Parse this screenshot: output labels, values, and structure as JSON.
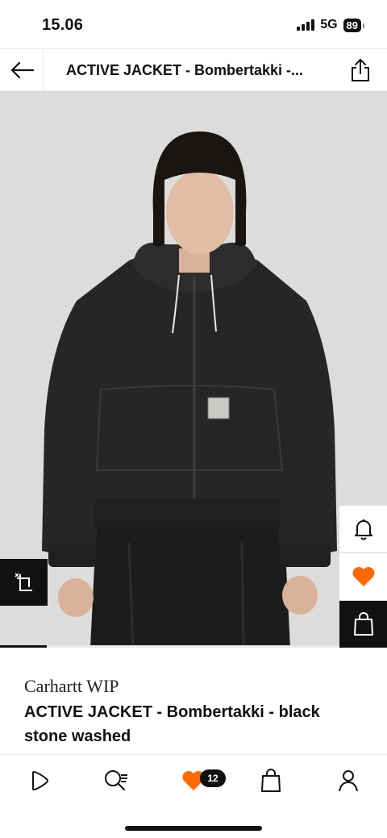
{
  "status_bar": {
    "time": "15.06",
    "network": "5G",
    "battery": "89"
  },
  "header": {
    "title": "ACTIVE JACKET - Bombertakki -...",
    "back_icon": "arrow-left-icon",
    "share_icon": "share-icon"
  },
  "image": {
    "image_progress": 0.12,
    "side_actions": {
      "notify_icon": "bell-icon",
      "wishlist_icon": "heart-filled-icon",
      "add_to_bag_icon": "shopping-bag-icon",
      "fit_icon": "fit-finder-icon"
    }
  },
  "product": {
    "brand": "Carhartt WIP",
    "name": "ACTIVE JACKET - Bombertakki - black stone washed"
  },
  "bottom_nav": {
    "items": [
      {
        "icon": "home-icon"
      },
      {
        "icon": "search-icon"
      },
      {
        "icon": "heart-filled-icon",
        "badge": "12"
      },
      {
        "icon": "bag-icon"
      },
      {
        "icon": "account-icon"
      }
    ]
  },
  "colors": {
    "accent_orange": "#ff6900",
    "text": "#111111",
    "image_background": "#dcdcdb",
    "jacket": "#262627"
  }
}
